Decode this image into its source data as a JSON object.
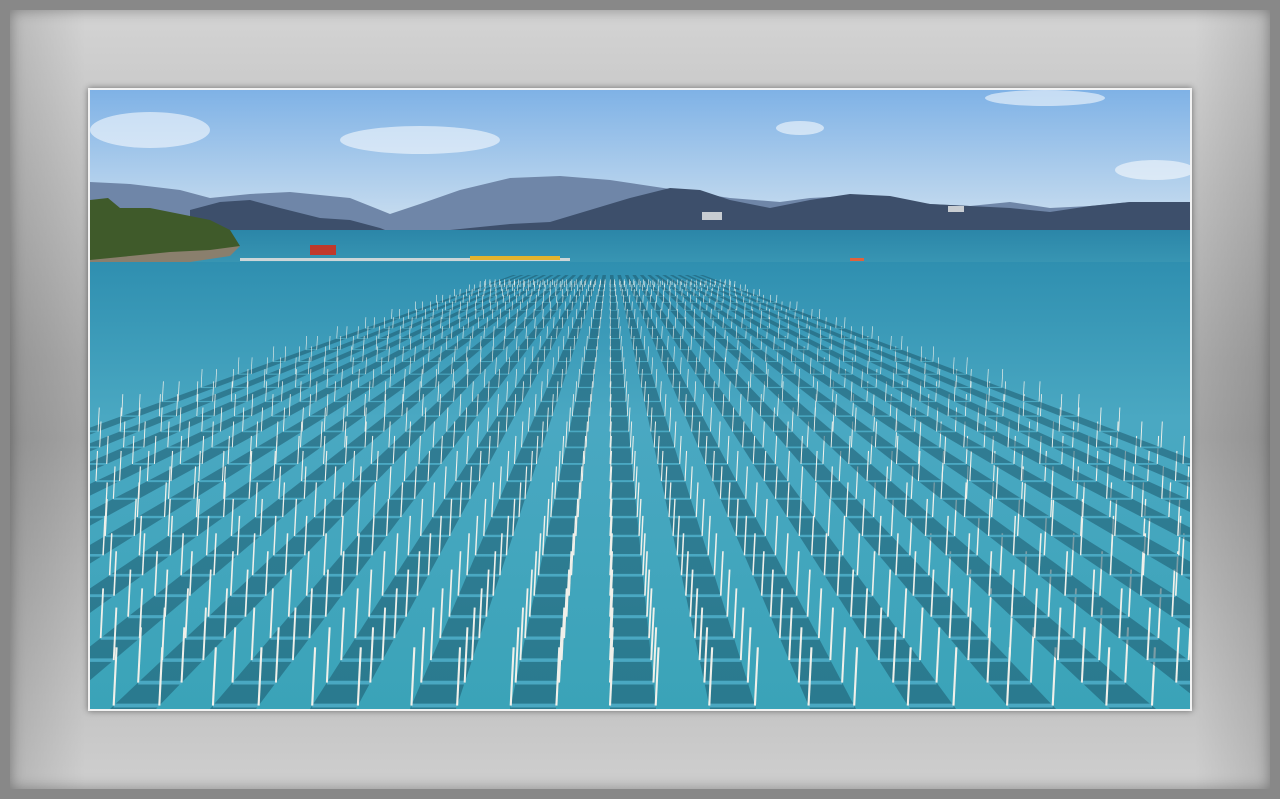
{
  "scene": {
    "subject": "seaweed-farm-aerial-photo",
    "colors": {
      "sky_top": "#7fb2e6",
      "sky_bottom": "#cfe1f0",
      "mountain_far": "#6f86a8",
      "mountain_near": "#3d4f6b",
      "sea_far": "#2f8fb0",
      "sea_near": "#3aa3b8",
      "net_dark": "#1d5a6d",
      "pole": "#f0f0ea",
      "shore_green": "#3f5a2a",
      "frame_mat": "#b5b5b5"
    }
  }
}
